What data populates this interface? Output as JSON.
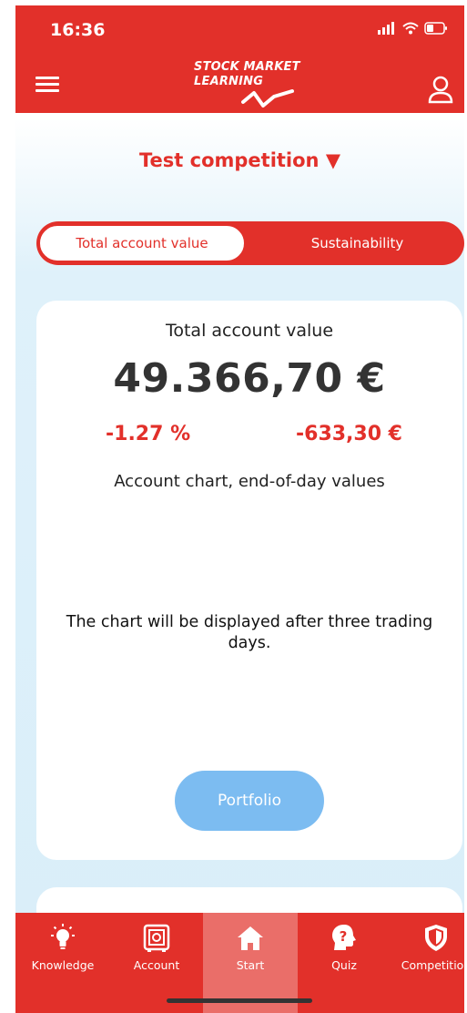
{
  "status_bar": {
    "time": "16:36"
  },
  "header": {
    "logo_line1": "STOCK MARKET",
    "logo_line2": "LEARNING"
  },
  "competition_selector": {
    "label": "Test competition ▼"
  },
  "toggle": {
    "active": "Total account value",
    "inactive": "Sustainability"
  },
  "account": {
    "title": "Total account value",
    "value": "49.366,70 €",
    "change_percent": "-1.27 %",
    "change_amount": "-633,30 €",
    "chart_heading": "Account chart, end-of-day values",
    "chart_message": "The chart will be displayed after three trading days.",
    "portfolio_button": "Portfolio"
  },
  "bottom_nav": {
    "items": [
      {
        "label": "Knowledge",
        "icon": "lightbulb-icon"
      },
      {
        "label": "Account",
        "icon": "safe-icon"
      },
      {
        "label": "Start",
        "icon": "home-icon",
        "active": true
      },
      {
        "label": "Quiz",
        "icon": "question-head-icon"
      },
      {
        "label": "Competition",
        "icon": "shield-icon"
      }
    ]
  },
  "colors": {
    "brand_red": "#e2302a",
    "button_blue": "#7cbcf1",
    "active_tab": "#ea6e69"
  }
}
